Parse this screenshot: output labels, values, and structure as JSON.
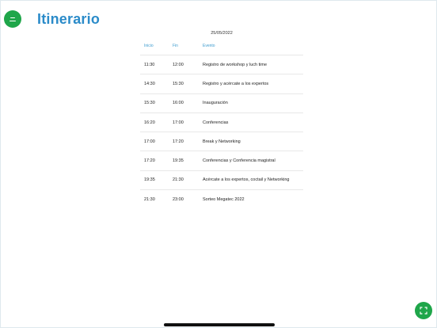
{
  "header": {
    "title": "Itinerario",
    "menu_icon": "menu-icon"
  },
  "itinerary": {
    "date": "25/05/2022",
    "columns": {
      "start": "Inicio",
      "end": "Fin",
      "event": "Evento"
    },
    "rows": [
      {
        "start": "11:30",
        "end": "12:00",
        "event": "Registro de workshop y luch time"
      },
      {
        "start": "14:30",
        "end": "15:30",
        "event": "Registro y acércate a los expertos"
      },
      {
        "start": "15:30",
        "end": "16:00",
        "event": "Inauguración"
      },
      {
        "start": "16:20",
        "end": "17:00",
        "event": "Conferencias"
      },
      {
        "start": "17:00",
        "end": "17:20",
        "event": "Break y Networking"
      },
      {
        "start": "17:20",
        "end": "19:35",
        "event": "Conferencias y Conferencia magistral"
      },
      {
        "start": "19:35",
        "end": "21:30",
        "event": "Acércate a los expertos, coctail y Networking"
      },
      {
        "start": "21:30",
        "end": "23:00",
        "event": "Sorteo Megatec 2022"
      }
    ]
  },
  "fab": {
    "icon": "expand-icon"
  },
  "colors": {
    "accent_green": "#1fa64a",
    "title_blue": "#2b8bc9",
    "header_blue": "#3e9ccf"
  }
}
